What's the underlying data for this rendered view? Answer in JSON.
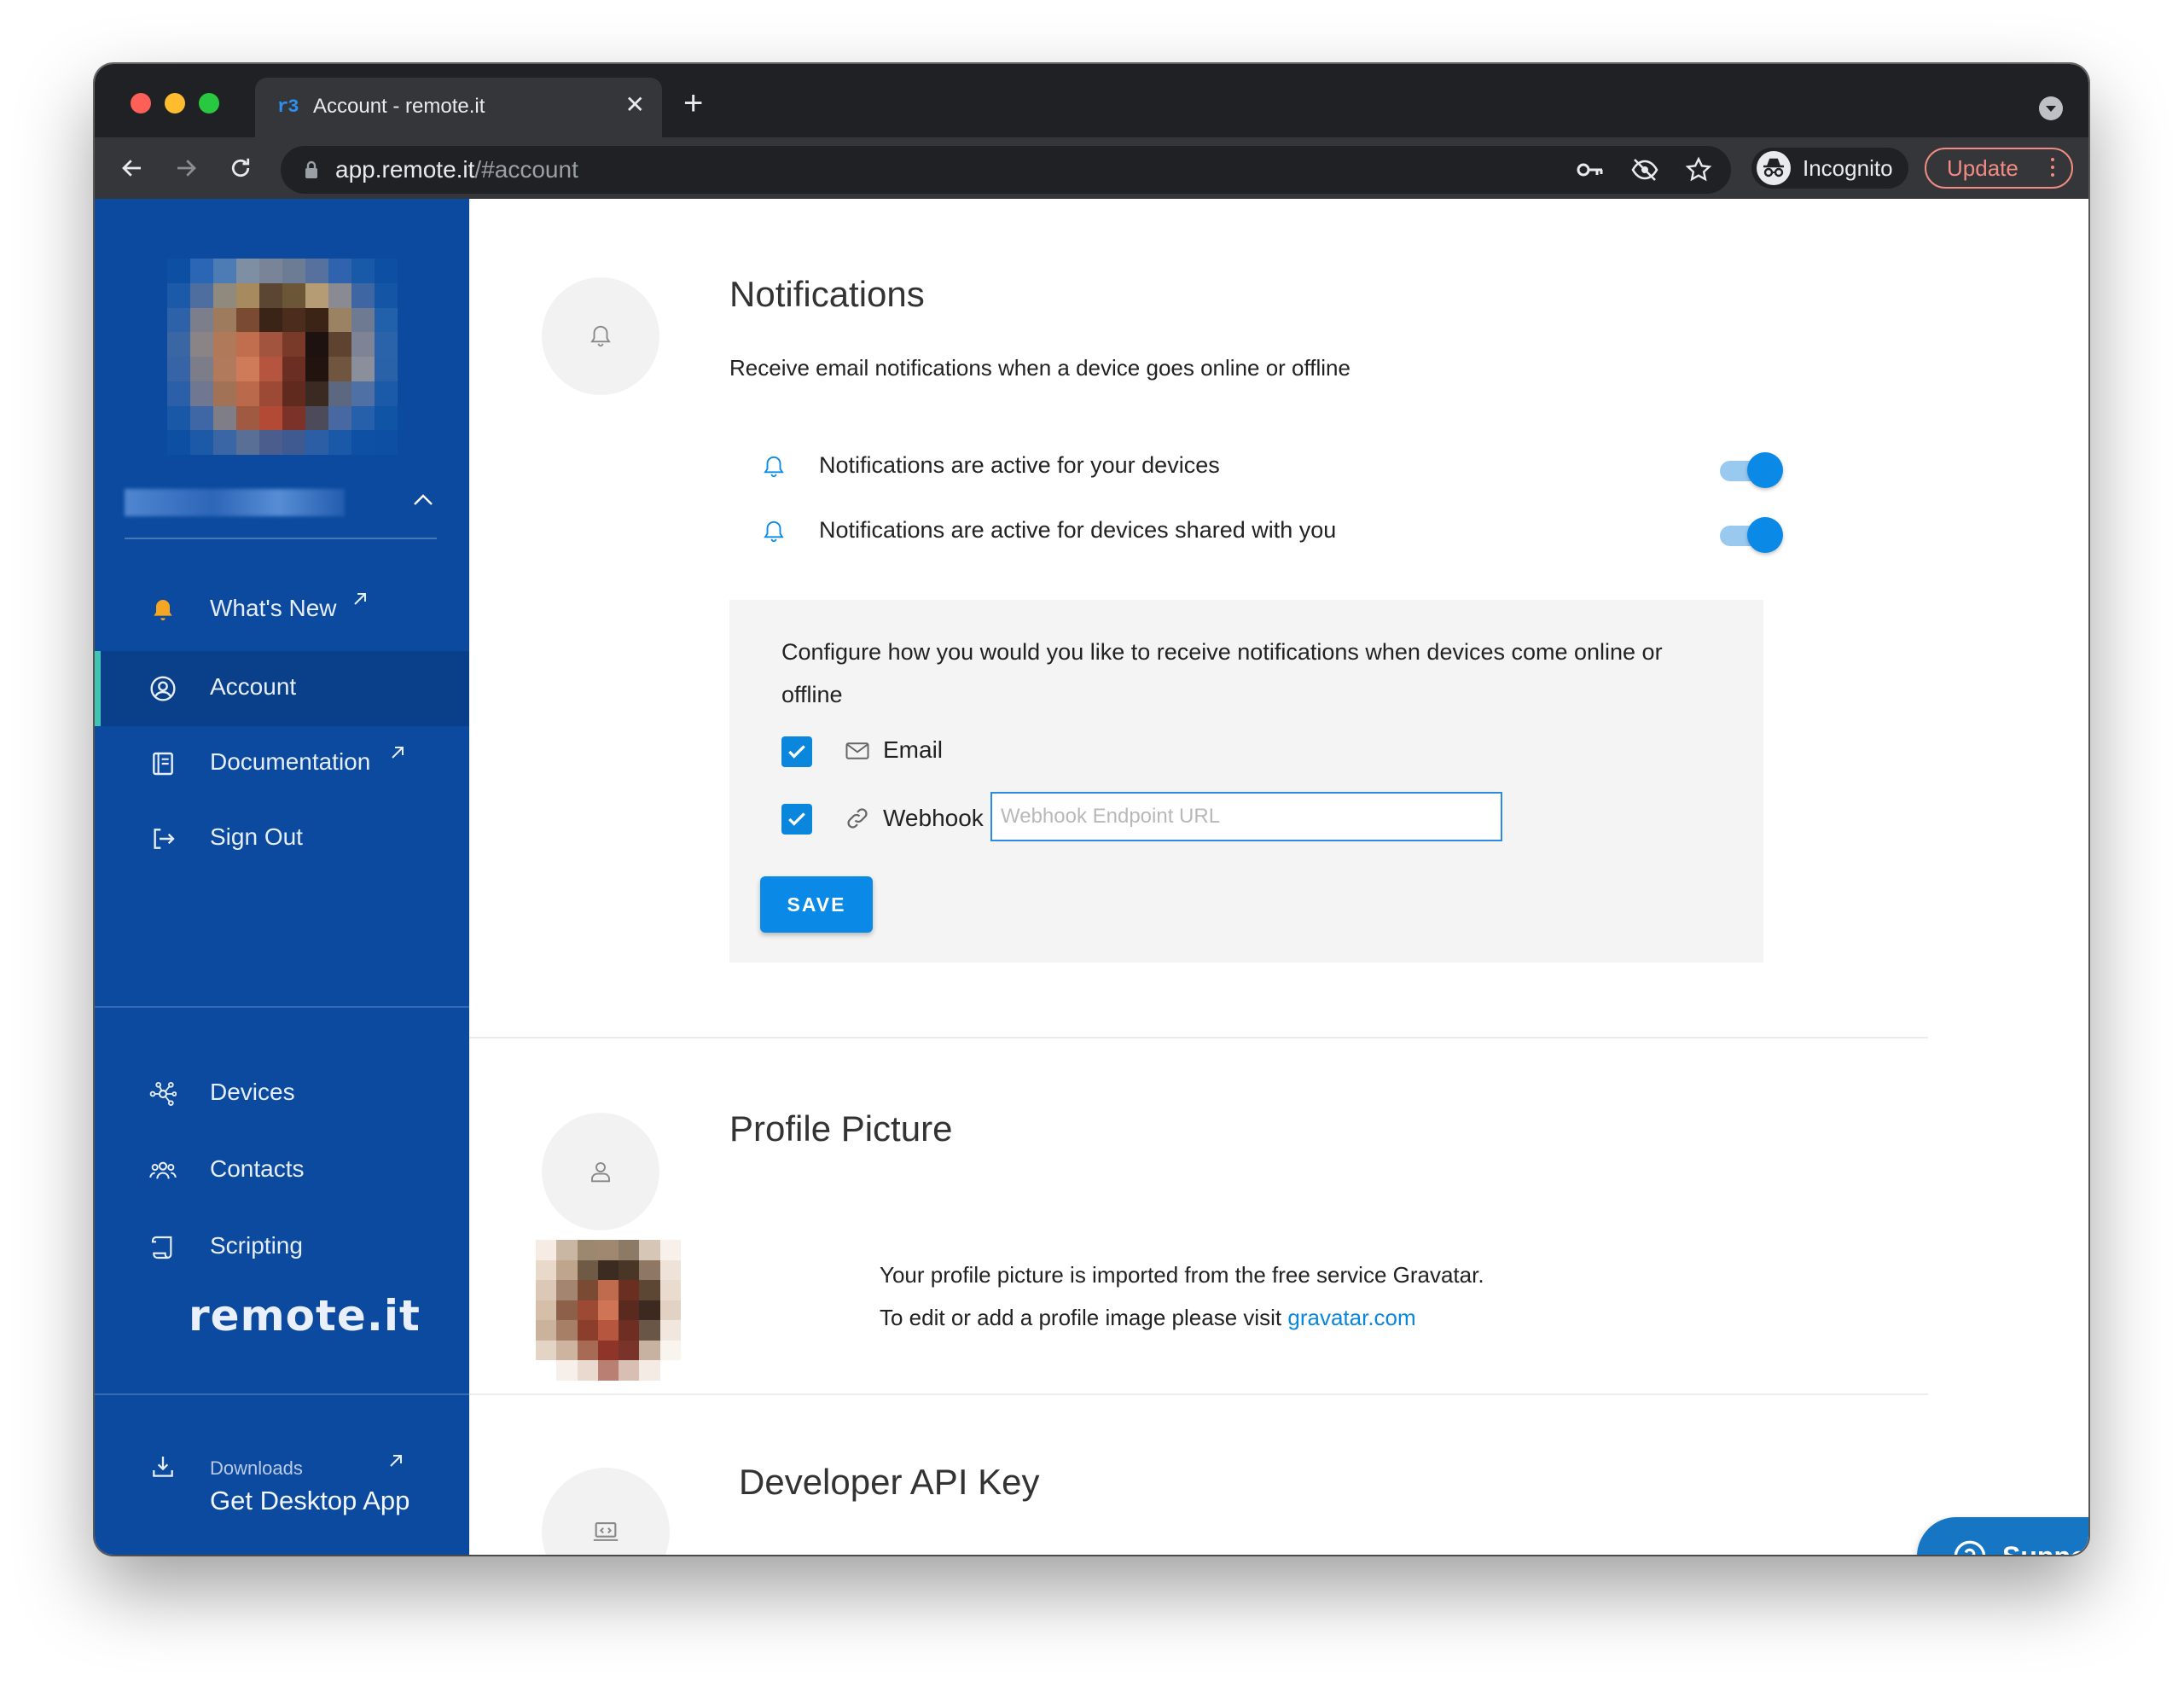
{
  "browser": {
    "tab_title": "Account - remote.it",
    "favicon_text": "r3",
    "url_host": "app.remote.it",
    "url_path": "/#account",
    "incognito_label": "Incognito",
    "update_label": "Update"
  },
  "sidebar": {
    "nav_top": [
      {
        "label": "What's New",
        "icon": "bell-icon",
        "external": true
      },
      {
        "label": "Account",
        "icon": "account-circle-icon",
        "active": true
      },
      {
        "label": "Documentation",
        "icon": "book-icon",
        "external": true
      },
      {
        "label": "Sign Out",
        "icon": "sign-out-icon"
      }
    ],
    "nav_main": [
      {
        "label": "Devices",
        "icon": "network-icon"
      },
      {
        "label": "Contacts",
        "icon": "contacts-icon"
      },
      {
        "label": "Scripting",
        "icon": "script-icon"
      }
    ],
    "brand": "remote.it",
    "downloads_small": "Downloads",
    "downloads_big": "Get Desktop App",
    "colors": {
      "background": "#0b4a9e",
      "active_indicator": "#40c4b4",
      "bell": "#f5a623"
    }
  },
  "notifications": {
    "title": "Notifications",
    "description": "Receive email notifications when a device goes online or offline",
    "toggles": [
      {
        "label": "Notifications are active for your devices",
        "on": true
      },
      {
        "label": "Notifications are active for devices shared with you",
        "on": true
      }
    ],
    "config_text": "Configure how you would you like to receive notifications when devices come online or offline",
    "email_label": "Email",
    "email_checked": true,
    "webhook_label": "Webhook",
    "webhook_checked": true,
    "webhook_placeholder": "Webhook Endpoint URL",
    "webhook_value": "",
    "save_label": "SAVE"
  },
  "profile_picture": {
    "title": "Profile Picture",
    "line1": "Your profile picture is imported from the free service Gravatar.",
    "line2_prefix": "To edit or add a profile image please visit ",
    "link_text": "gravatar.com"
  },
  "developer_api": {
    "title": "Developer API Key"
  },
  "support": {
    "label": "Support"
  },
  "accent_color": "#0a8ae6"
}
